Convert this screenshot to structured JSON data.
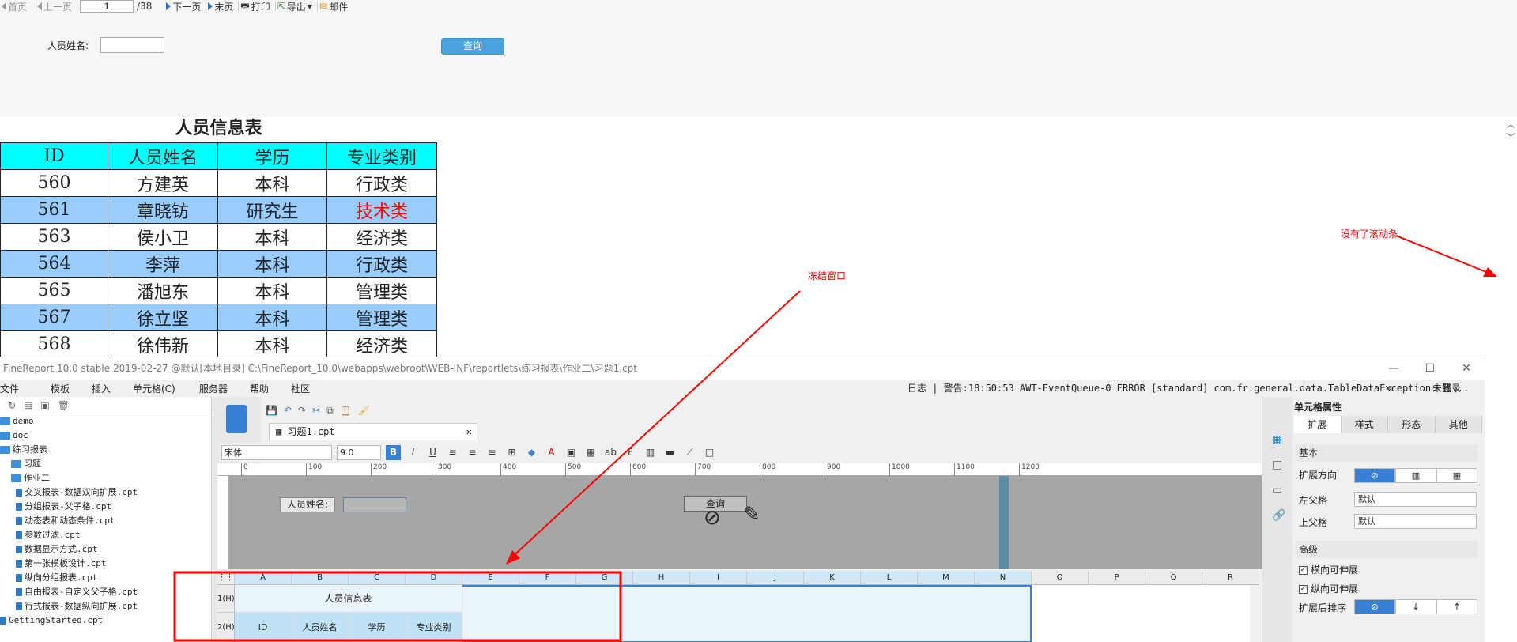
{
  "toolbar": {
    "first": "首页",
    "prev": "上一页",
    "page_value": "1",
    "page_total": "/38",
    "next": "下一页",
    "last": "末页",
    "print": "打印",
    "export": "导出",
    "mail": "邮件"
  },
  "param": {
    "name_label": "人员姓名:",
    "name_value": "",
    "query_button": "查询"
  },
  "report": {
    "title": "人员信息表",
    "headers": [
      "ID",
      "人员姓名",
      "学历",
      "专业类别"
    ],
    "rows": [
      [
        "560",
        "方建英",
        "本科",
        "行政类"
      ],
      [
        "561",
        "章晓钫",
        "研究生",
        "技术类"
      ],
      [
        "563",
        "侯小卫",
        "本科",
        "经济类"
      ],
      [
        "564",
        "李萍",
        "本科",
        "行政类"
      ],
      [
        "565",
        "潘旭东",
        "本科",
        "管理类"
      ],
      [
        "567",
        "徐立坚",
        "本科",
        "管理类"
      ],
      [
        "568",
        "徐伟新",
        "本科",
        "经济类"
      ]
    ],
    "highlight_color": "#ff0000",
    "header_color": "#00ffff",
    "alt_row_color": "#99ccff"
  },
  "annotations": {
    "freeze_window": "冻结窗口",
    "no_scrollbar": "没有了滚动条"
  },
  "designer": {
    "title": "FineReport 10.0 stable 2019-02-27 @默认[本地目录]    C:\\FineReport_10.0\\webapps\\webroot\\WEB-INF\\reportlets\\练习报表\\作业二\\习题1.cpt",
    "menus": [
      "文件",
      "模板",
      "插入",
      "单元格(C)",
      "服务器",
      "帮助",
      "社区"
    ],
    "log_text": "日志 | 警告:18:50:53 AWT-EventQueue-0 ERROR [standard] com.fr.general.data.TableDataException: 错...",
    "login": "未登录",
    "tree": [
      {
        "label": "demo",
        "type": "folder",
        "indent": 0
      },
      {
        "label": "doc",
        "type": "folder",
        "indent": 0
      },
      {
        "label": "练习报表",
        "type": "folder",
        "indent": 0
      },
      {
        "label": "习题",
        "type": "folder",
        "indent": 1
      },
      {
        "label": "作业二",
        "type": "folder",
        "indent": 1
      },
      {
        "label": "交叉报表-数据双向扩展.cpt",
        "type": "file",
        "indent": 2
      },
      {
        "label": "分组报表-父子格.cpt",
        "type": "file",
        "indent": 2
      },
      {
        "label": "动态表和动态条件.cpt",
        "type": "file",
        "indent": 2
      },
      {
        "label": "参数过滤.cpt",
        "type": "file",
        "indent": 2
      },
      {
        "label": "数据显示方式.cpt",
        "type": "file",
        "indent": 2
      },
      {
        "label": "第一张模板设计.cpt",
        "type": "file",
        "indent": 2
      },
      {
        "label": "纵向分组报表.cpt",
        "type": "file",
        "indent": 2
      },
      {
        "label": "自由报表-自定义父子格.cpt",
        "type": "file",
        "indent": 2
      },
      {
        "label": "行式报表-数据纵向扩展.cpt",
        "type": "file",
        "indent": 2
      },
      {
        "label": "GettingStarted.cpt",
        "type": "file",
        "indent": 0
      }
    ],
    "tab_label": "习题1.cpt",
    "font_name": "宋体",
    "font_size": "9.0",
    "ruler_ticks": [
      "0",
      "100",
      "200",
      "300",
      "400",
      "500",
      "600",
      "700",
      "800",
      "900",
      "1000",
      "1100",
      "1200"
    ],
    "param_canvas": {
      "label": "人员姓名:",
      "button": "查询"
    },
    "columns": [
      "A",
      "B",
      "C",
      "D",
      "E",
      "F",
      "G",
      "H",
      "I",
      "J",
      "K",
      "L",
      "M",
      "N",
      "O",
      "P",
      "Q",
      "R"
    ],
    "row_headers": [
      "1(H)",
      "2(H)"
    ],
    "cell_title": "人员信息表",
    "cell_headers": [
      "ID",
      "人员姓名",
      "学历",
      "专业类别"
    ],
    "right_panel": {
      "title": "单元格属性",
      "tabs": [
        "扩展",
        "样式",
        "形态",
        "其他"
      ],
      "basic": "基本",
      "direction_label": "扩展方向",
      "left_parent_label": "左父格",
      "left_parent_value": "默认",
      "up_parent_label": "上父格",
      "up_parent_value": "默认",
      "advanced": "高级",
      "h_stretch": "横向可伸展",
      "v_stretch": "纵向可伸展",
      "sort_label": "扩展后排序"
    }
  }
}
